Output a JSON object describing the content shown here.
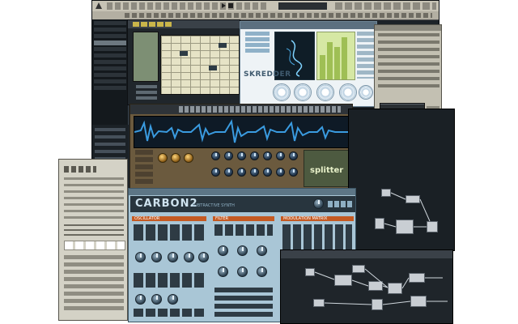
{
  "plugin_stereo": {
    "name": "SKREDDER"
  },
  "carbon": {
    "title": "CARBON2",
    "subtitle": "SUBTRACTIVE SYNTH",
    "section_oscillator": "OSCILLATOR",
    "section_filter": "FILTER",
    "section_modulation": "MODULATION MATRIX"
  },
  "sampler": {
    "name": "splitter"
  },
  "colors": {
    "dark_panel": "#1d2329",
    "carbon_blue": "#a9c6d6",
    "sampler_brown": "#6b5a3e",
    "waveform": "#2f7fbf",
    "display_yellow": "#e8e6a8",
    "menu_gray": "#c7c3b5"
  },
  "icons": {
    "app": "reaktor-logo-icon",
    "play": "play-icon",
    "stop": "stop-icon"
  }
}
